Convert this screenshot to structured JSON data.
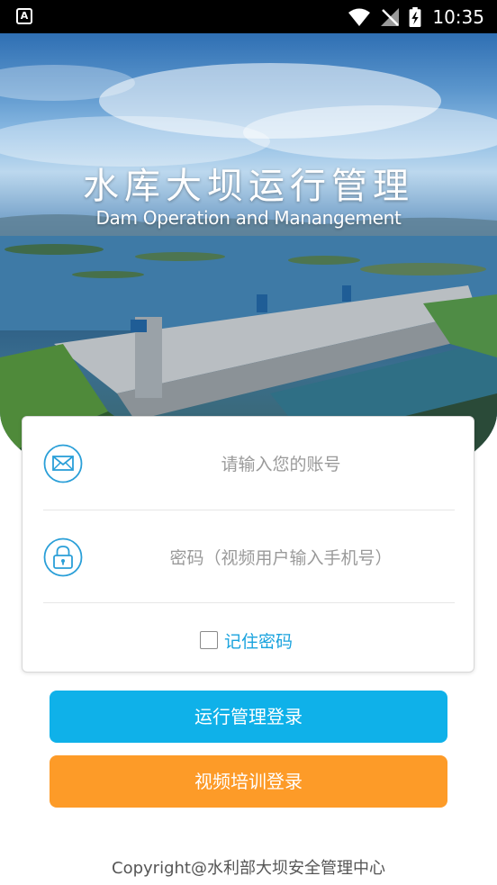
{
  "status_bar": {
    "time": "10:35",
    "left_icon": "A",
    "icons": [
      "wifi-icon",
      "no-signal-icon",
      "battery-charging-icon"
    ]
  },
  "hero": {
    "title": "水库大坝运行管理",
    "subtitle": "Dam Operation and Manangement"
  },
  "login": {
    "account_placeholder": "请输入您的账号",
    "password_placeholder": "密码（视频用户输入手机号）",
    "remember_label": "记住密码",
    "remember_checked": false
  },
  "buttons": {
    "ops_login": "运行管理登录",
    "video_login": "视频培训登录"
  },
  "footer": {
    "copyright": "Copyright@水利部大坝安全管理中心"
  },
  "colors": {
    "accent_blue": "#0fb1e9",
    "accent_orange": "#fd9b28",
    "link_blue": "#1aa3de",
    "icon_blue": "#2a9fd8"
  }
}
